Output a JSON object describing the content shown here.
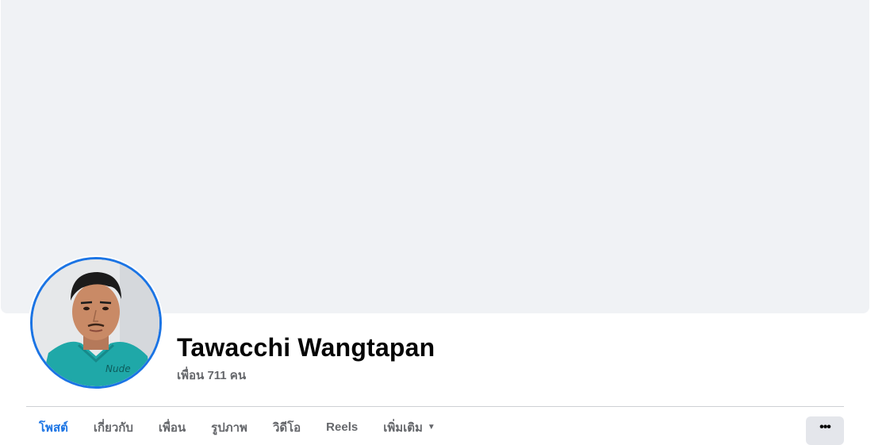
{
  "profile": {
    "name": "Tawacchi Wangtapan",
    "friends_text": "เพื่อน 711 คน",
    "avatar_border_color": "#1b74e4"
  },
  "tabs": [
    {
      "label": "โพสต์",
      "active": true
    },
    {
      "label": "เกี่ยวกับ",
      "active": false
    },
    {
      "label": "เพื่อน",
      "active": false
    },
    {
      "label": "รูปภาพ",
      "active": false
    },
    {
      "label": "วิดีโอ",
      "active": false
    },
    {
      "label": "Reels",
      "active": false
    },
    {
      "label": "เพิ่มเติม",
      "active": false,
      "icon": "caret-down-icon"
    }
  ],
  "more_button": {
    "label": "•••",
    "icon": "more-options-icon"
  },
  "colors": {
    "cover_bg": "#f0f2f5",
    "accent": "#1b74e4",
    "muted_text": "#65676b"
  }
}
